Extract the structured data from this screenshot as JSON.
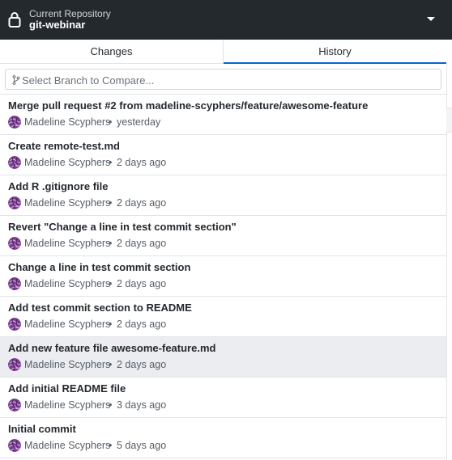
{
  "header": {
    "caption": "Current Repository",
    "repo_name": "git-webinar",
    "lock_icon": "lock-icon",
    "dropdown_icon": "caret-down-icon"
  },
  "tabs": [
    {
      "label": "Changes",
      "selected": false
    },
    {
      "label": "History",
      "selected": true
    }
  ],
  "branch_compare": {
    "placeholder": "Select Branch to Compare...",
    "icon": "git-branch-icon"
  },
  "commits": [
    {
      "summary": "Merge pull request #2 from madeline-scyphers/feature/awesome-feature",
      "author": "Madeline Scyphers",
      "separator": "•",
      "time": "yesterday",
      "selected": false
    },
    {
      "summary": "Create remote-test.md",
      "author": "Madeline Scyphers",
      "separator": "•",
      "time": "2 days ago",
      "selected": false
    },
    {
      "summary": "Add R .gitignore file",
      "author": "Madeline Scyphers",
      "separator": "•",
      "time": "2 days ago",
      "selected": false
    },
    {
      "summary": "Revert \"Change a line in test commit section\"",
      "author": "Madeline Scyphers",
      "separator": "•",
      "time": "2 days ago",
      "selected": false
    },
    {
      "summary": "Change a line in test commit section",
      "author": "Madeline Scyphers",
      "separator": "•",
      "time": "2 days ago",
      "selected": false
    },
    {
      "summary": "Add test commit section to README",
      "author": "Madeline Scyphers",
      "separator": "•",
      "time": "2 days ago",
      "selected": false
    },
    {
      "summary": "Add new feature file awesome-feature.md",
      "author": "Madeline Scyphers",
      "separator": "•",
      "time": "2 days ago",
      "selected": true
    },
    {
      "summary": "Add initial README file",
      "author": "Madeline Scyphers",
      "separator": "•",
      "time": "3 days ago",
      "selected": false
    },
    {
      "summary": "Initial commit",
      "author": "Madeline Scyphers",
      "separator": "•",
      "time": "5 days ago",
      "selected": false
    }
  ],
  "colors": {
    "header_bg": "#24292e",
    "tab_underline": "#0366d6",
    "selected_row": "#ebedf0",
    "avatar": "#7a3f8f"
  }
}
